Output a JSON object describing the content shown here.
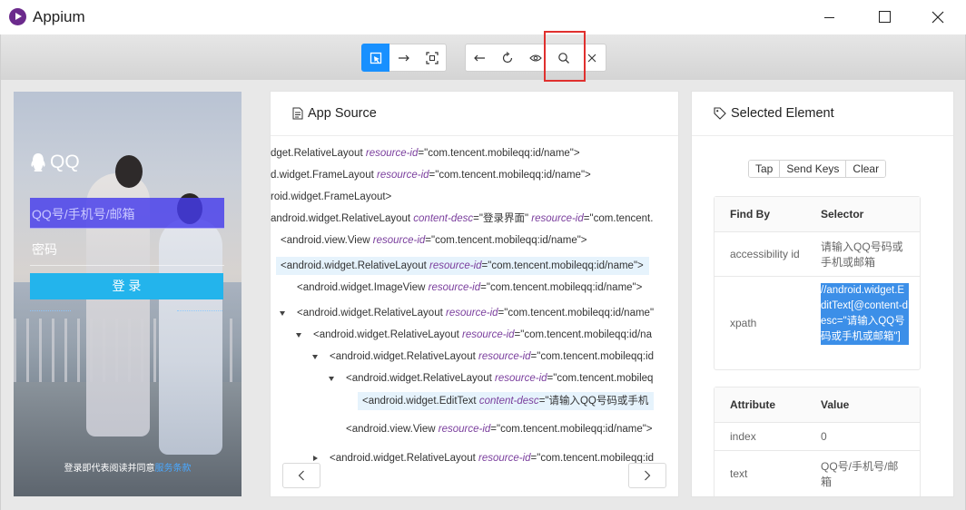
{
  "window": {
    "title": "Appium"
  },
  "toolbar": {
    "buttons": [
      {
        "id": "select",
        "icon": "select-elements-icon",
        "active": true
      },
      {
        "id": "swipe",
        "icon": "swipe-arrow-icon"
      },
      {
        "id": "tap-coords",
        "icon": "tap-coordinates-icon"
      },
      {
        "id": "back",
        "icon": "back-arrow-icon"
      },
      {
        "id": "refresh",
        "icon": "refresh-icon"
      },
      {
        "id": "show-source",
        "icon": "eye-icon"
      },
      {
        "id": "search",
        "icon": "search-icon"
      },
      {
        "id": "quit",
        "icon": "close-icon"
      }
    ],
    "highlight_color": "#e0302e",
    "accent_color": "#1890ff"
  },
  "device": {
    "brand": "QQ",
    "account_placeholder": "QQ号/手机号/邮箱",
    "password_placeholder": "密码",
    "login_label": "登 录",
    "agreement_prefix": "登录即代表阅读并同意",
    "agreement_link": "服务条款"
  },
  "source": {
    "title": "App Source",
    "rows": [
      {
        "tag": "dget.RelativeLayout",
        "attr": "resource-id",
        "val": "\"com.tencent.mobileqq:id/name\">"
      },
      {
        "tag": "d.widget.FrameLayout",
        "attr": "resource-id",
        "val": "\"com.tencent.mobileqq:id/name\">"
      },
      {
        "tag": "roid.widget.FrameLayout>",
        "attr": "",
        "val": ""
      },
      {
        "tag": "android.widget.RelativeLayout",
        "attr": "content-desc",
        "val": "\"登录界面\"",
        "attr2": "resource-id",
        "val2": "\"com.tencent."
      },
      {
        "tag": "<android.view.View",
        "attr": "resource-id",
        "val": "\"com.tencent.mobileqq:id/name\">"
      },
      {
        "tag": "<android.widget.RelativeLayout",
        "attr": "resource-id",
        "val": "\"com.tencent.mobileqq:id/name\">"
      },
      {
        "tag": "<android.widget.ImageView",
        "attr": "resource-id",
        "val": "\"com.tencent.mobileqq:id/name\">"
      },
      {
        "tag": "<android.widget.RelativeLayout",
        "attr": "resource-id",
        "val": "\"com.tencent.mobileqq:id/name\""
      },
      {
        "tag": "<android.widget.RelativeLayout",
        "attr": "resource-id",
        "val": "\"com.tencent.mobileqq:id/na"
      },
      {
        "tag": "<android.widget.RelativeLayout",
        "attr": "resource-id",
        "val": "\"com.tencent.mobileqq:id"
      },
      {
        "tag": "<android.widget.RelativeLayout",
        "attr": "resource-id",
        "val": "\"com.tencent.mobileq"
      },
      {
        "tag": "<android.widget.EditText",
        "attr": "content-desc",
        "val": "\"请输入QQ号码或手机"
      },
      {
        "tag": "<android.view.View",
        "attr": "resource-id",
        "val": "\"com.tencent.mobileqq:id/name\">"
      },
      {
        "tag": "<android.widget.RelativeLayout",
        "attr": "resource-id",
        "val": "\"com.tencent.mobileqq:id"
      }
    ]
  },
  "selected": {
    "title": "Selected Element",
    "actions": [
      "Tap",
      "Send Keys",
      "Clear"
    ],
    "findby_header": [
      "Find By",
      "Selector"
    ],
    "findby": [
      {
        "by": "accessibility id",
        "selector": "请输入QQ号码或手机或邮箱"
      },
      {
        "by": "xpath",
        "selector": "//android.widget.EditText[@content-desc=\"请输入QQ号码或手机或邮箱\"]"
      }
    ],
    "attr_header": [
      "Attribute",
      "Value"
    ],
    "attributes": [
      {
        "name": "index",
        "value": "0"
      },
      {
        "name": "text",
        "value": "QQ号/手机号/邮箱"
      }
    ]
  }
}
